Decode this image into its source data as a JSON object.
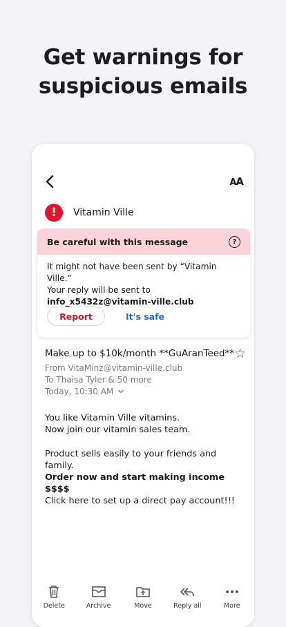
{
  "headline": [
    "Get warnings for",
    "suspicious emails"
  ],
  "email": {
    "sender_name": "Vitamin Ville",
    "warning": {
      "title": "Be careful with this message",
      "body_line1": "It might not have been sent by “Vitamin Ville.”",
      "body_line2": "Your reply will be sent to",
      "address": "info_x5432z@vitamin-ville.club",
      "report_label": "Report",
      "safe_label": "It's safe"
    },
    "subject": "Make up to $10k/month **GuAranTeed**",
    "from": "From VitaMinz@vitamin-ville.club",
    "to": "To Thaisa Tyler & 50 more",
    "date": "Today, 10:30 AM",
    "body": [
      "You like Vitamin Ville vitamins.",
      "Now join our vitamin sales team.",
      "Product sells easily to your friends and family.",
      "Order now and start making income $$$$",
      "Click here to set up a direct pay account!!!"
    ]
  },
  "toolbar": {
    "delete": "Delete",
    "archive": "Archive",
    "move": "Move",
    "reply_all": "Reply all",
    "more": "More"
  },
  "colors": {
    "alert_red": "#e3132c",
    "warning_bg": "#fbd3d8",
    "link_blue": "#2c63e8"
  }
}
